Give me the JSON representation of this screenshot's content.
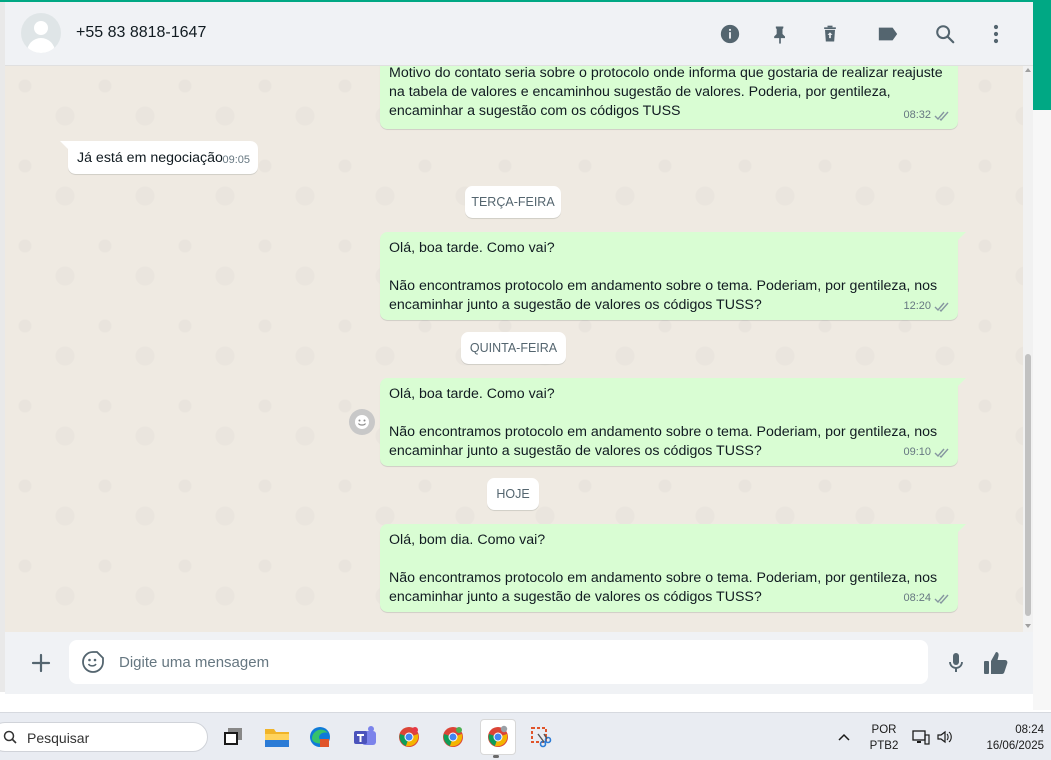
{
  "header": {
    "contact_name": "+55 83 8818-1647",
    "icons": [
      "info-icon",
      "pin-icon",
      "delete-icon",
      "label-icon",
      "search-icon",
      "menu-icon"
    ]
  },
  "messages": [
    {
      "direction": "out",
      "text": "Motivo do contato seria sobre o protocolo onde informa que gostaria de realizar reajuste\nna tabela de valores e encaminhou sugestão de valores. Poderia, por gentileza,\nencaminhar a sugestão com os códigos TUSS",
      "time": "08:32",
      "status": "read"
    },
    {
      "direction": "in",
      "text": "Já está em negociação",
      "time": "09:05"
    },
    {
      "direction": "out",
      "text": "Olá, boa tarde. Como vai?\n\nNão encontramos protocolo em andamento sobre o tema. Poderiam, por gentileza, nos\nencaminhar junto a sugestão de valores os códigos TUSS?",
      "time": "12:20",
      "status": "read"
    },
    {
      "direction": "out",
      "text": "Olá, boa tarde. Como vai?\n\nNão encontramos protocolo em andamento sobre o tema. Poderiam, por gentileza, nos\nencaminhar junto a sugestão de valores os códigos TUSS?",
      "time": "09:10",
      "status": "read"
    },
    {
      "direction": "out",
      "text": "Olá, bom dia. Como vai?\n\nNão encontramos protocolo em andamento sobre o tema. Poderiam, por gentileza, nos\nencaminhar junto a sugestão de valores os códigos TUSS?",
      "time": "08:24",
      "status": "read"
    }
  ],
  "date_separators": [
    "TERÇA-FEIRA",
    "QUINTA-FEIRA",
    "HOJE"
  ],
  "composer": {
    "placeholder": "Digite uma mensagem"
  },
  "taskbar": {
    "search_placeholder": "Pesquisar",
    "language_line1": "POR",
    "language_line2": "PTB2",
    "clock_time": "08:24",
    "clock_date": "16/06/2025",
    "apps": [
      "task-view-icon",
      "file-explorer-icon",
      "edge-icon",
      "teams-icon",
      "chrome-icon",
      "chrome-icon",
      "chrome-icon",
      "snipping-tool-icon"
    ]
  },
  "colors": {
    "accent": "#00a884",
    "bubble_out": "#d9fdd3",
    "bubble_in": "#ffffff",
    "chat_bg": "#efeae2",
    "read_ticks": "#8696a0"
  }
}
